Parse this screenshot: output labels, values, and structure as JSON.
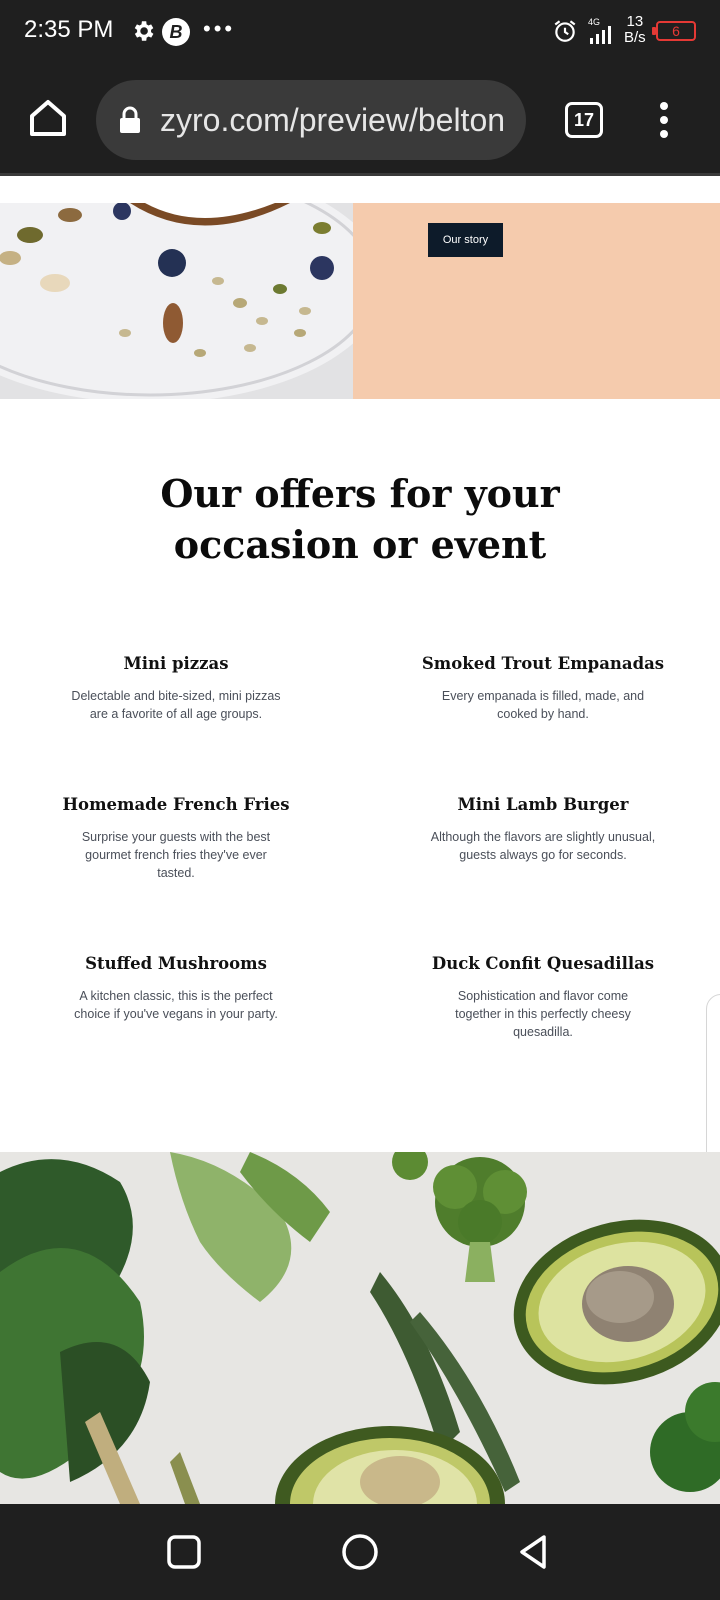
{
  "status_bar": {
    "time": "2:35 PM",
    "network_speed_value": "13",
    "network_speed_unit": "B/s",
    "network_type": "4G",
    "battery_level": "6"
  },
  "browser": {
    "url": "zyro.com/preview/belton",
    "tab_count": "17"
  },
  "hero": {
    "our_story_label": "Our story"
  },
  "offers_section": {
    "title_line1": "Our offers for your",
    "title_line2": "occasion or event",
    "items": [
      {
        "title": "Mini pizzas",
        "description": "Delectable and bite-sized, mini pizzas are a favorite of all age groups."
      },
      {
        "title": "Smoked Trout Empanadas",
        "description": "Every empanada is filled, made, and cooked by hand."
      },
      {
        "title": "Homemade French Fries",
        "description": "Surprise your guests with the best gourmet french fries they've ever tasted."
      },
      {
        "title": "Mini Lamb Burger",
        "description": "Although the flavors are slightly unusual, guests always go for seconds."
      },
      {
        "title": "Stuffed Mushrooms",
        "description": "A kitchen classic, this is the perfect choice if you've vegans in your party."
      },
      {
        "title": "Duck Confit Quesadillas",
        "description": "Sophistication and flavor come together in this perfectly cheesy quesadilla."
      }
    ]
  },
  "colors": {
    "chrome_bg": "#1f1f1f",
    "url_pill_bg": "#3a3a3a",
    "hero_panel_bg": "#f5cbad",
    "button_bg": "#0d1b2a",
    "battery_alert": "#e53935"
  },
  "icons": {
    "settings": "gear-icon",
    "app_b": "b-app-icon",
    "alarm": "alarm-icon",
    "signal": "signal-icon",
    "home": "home-icon",
    "lock": "lock-icon",
    "menu": "more-vert-icon",
    "recents": "square-icon",
    "home_nav": "circle-icon",
    "back": "triangle-back-icon"
  }
}
